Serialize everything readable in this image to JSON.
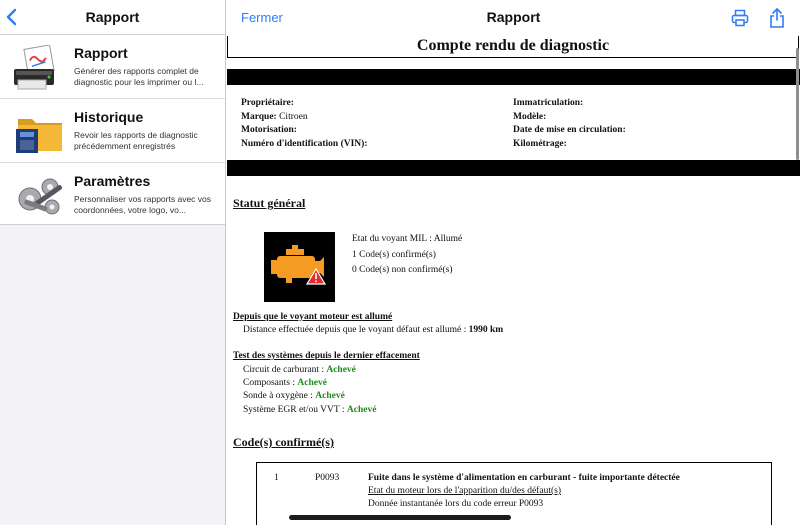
{
  "sidebar": {
    "title": "Rapport",
    "items": [
      {
        "label": "Rapport",
        "desc": "Générer des rapports complet de diagnostic pour les imprimer ou l...",
        "icon": "printer-report-icon"
      },
      {
        "label": "Historique",
        "desc": "Revoir les rapports de diagnostic précédemment enregistrés",
        "icon": "folder-icon"
      },
      {
        "label": "Paramètres",
        "desc": "Personnaliser vos rapports avec vos coordonnées, votre logo, vo...",
        "icon": "gears-icon"
      }
    ]
  },
  "header": {
    "close_label": "Fermer",
    "title": "Rapport",
    "accent": "#2f7cf6"
  },
  "document": {
    "title": "Compte rendu de diagnostic",
    "info_left": [
      {
        "label": "Propriétaire",
        "value": ""
      },
      {
        "label": "Marque",
        "value": "Citroen"
      },
      {
        "label": "Motorisation",
        "value": ""
      },
      {
        "label": "Numéro d'identification (VIN)",
        "value": ""
      }
    ],
    "info_right": [
      {
        "label": "Immatriculation",
        "value": ""
      },
      {
        "label": "Modèle",
        "value": ""
      },
      {
        "label": "Date de mise en circulation",
        "value": ""
      },
      {
        "label": "Kilométrage",
        "value": ""
      }
    ],
    "statut_heading": "Statut général",
    "statut_lines": [
      "Etat du voyant MIL : Allumé",
      "1 Code(s) confirmé(s)",
      "0 Code(s) non confirmé(s)"
    ],
    "mil_heading": "Depuis que le voyant moteur est allumé",
    "mil_distance_label": "Distance effectuée depuis que le voyant défaut est allumé : ",
    "mil_distance_value": "1990 km",
    "tests_heading": "Test des systèmes depuis le dernier effacement",
    "tests": [
      {
        "label": "Circuit de carburant : ",
        "status": "Achevé"
      },
      {
        "label": "Composants : ",
        "status": "Achevé"
      },
      {
        "label": "Sonde à oxygène : ",
        "status": "Achevé"
      },
      {
        "label": "Système EGR et/ou VVT : ",
        "status": "Achevé"
      }
    ],
    "status_color": "#1e8c1e",
    "codes_heading": "Code(s) confirmé(s)",
    "codes": [
      {
        "index": "1",
        "code": "P0093",
        "description": "Fuite dans le système d'alimentation en carburant - fuite importante détectée",
        "state_label": "Etat du moteur lors de l'apparition du/des défaut(s)",
        "snapshot_label": "Donnée instantanée lors du code erreur P0093"
      }
    ]
  }
}
